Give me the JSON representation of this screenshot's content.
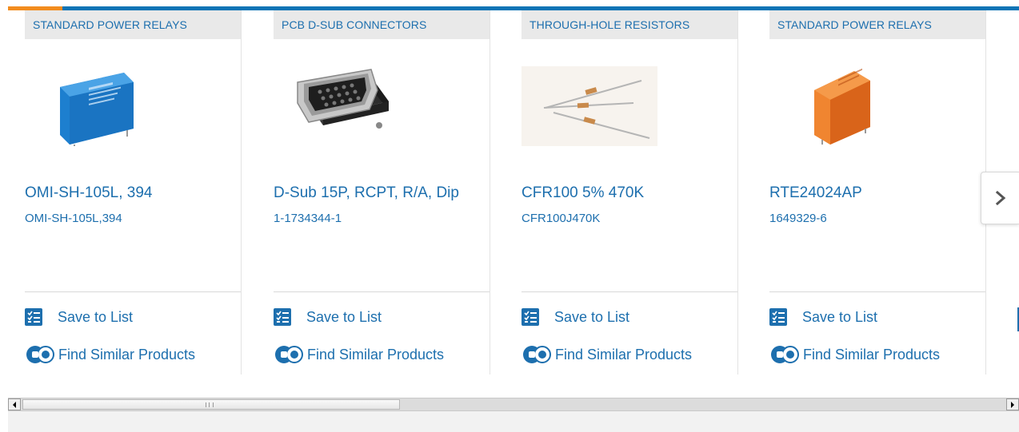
{
  "carousel": {
    "products": [
      {
        "category": "STANDARD POWER RELAYS",
        "title": "OMI-SH-105L, 394",
        "part_number": "OMI-SH-105L,394",
        "save_label": "Save to List",
        "find_label": "Find Similar Products",
        "image": "blue-relay-photo"
      },
      {
        "category": "PCB D-SUB CONNECTORS",
        "title": "D-Sub 15P, RCPT, R/A, Dip",
        "part_number": "1-1734344-1",
        "save_label": "Save to List",
        "find_label": "Find Similar Products",
        "image": "dsub-connector-photo"
      },
      {
        "category": "THROUGH-HOLE RESISTORS",
        "title": "CFR100 5% 470K",
        "part_number": "CFR100J470K",
        "save_label": "Save to List",
        "find_label": "Find Similar Products",
        "image": "resistors-photo"
      },
      {
        "category": "STANDARD POWER RELAYS",
        "title": "RTE24024AP",
        "part_number": "1649329-6",
        "save_label": "Save to List",
        "find_label": "Find Similar Products",
        "image": "orange-relay-photo"
      }
    ],
    "next_icon": "chevron-right-icon",
    "colors": {
      "accent": "#0d74b5",
      "highlight": "#f28c1e",
      "link": "#1d6fae",
      "category_bg": "#e9e9e9"
    }
  },
  "scrollbar": {
    "orientation": "horizontal",
    "position": 0.0
  }
}
